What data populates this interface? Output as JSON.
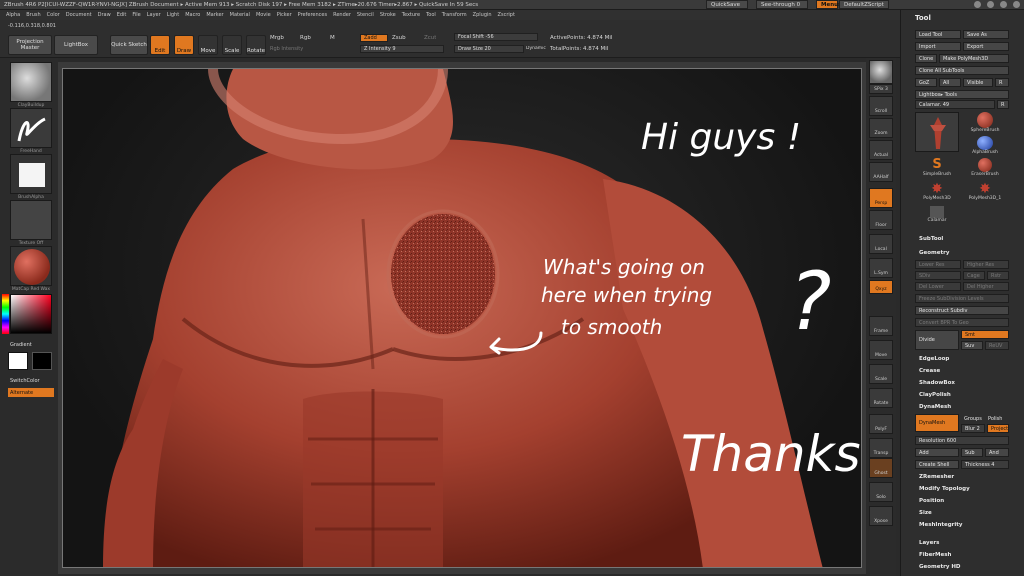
{
  "titlebar": {
    "app_title": "ZBrush 4R6 P2[ICUI-WZZF-QW1R-YNVI-NGJX]    ZBrush Document    ▸ Active Mem 913 ▸ Scratch Disk 197 ▸ Free Mem 3182 ▸ ZTime▸20.676 Timer▸2.867 ▸ QuickSave In 59 Secs",
    "quicksave": "QuickSave",
    "seethrough": "See-through  0",
    "menus": "Menus",
    "script": "DefaultZScript"
  },
  "menubar": [
    "Alpha",
    "Brush",
    "Color",
    "Document",
    "Draw",
    "Edit",
    "File",
    "Layer",
    "Light",
    "Macro",
    "Marker",
    "Material",
    "Movie",
    "Picker",
    "Preferences",
    "Render",
    "Stencil",
    "Stroke",
    "Texture",
    "Tool",
    "Transform",
    "Zplugin",
    "Zscript"
  ],
  "shelf": {
    "coords": "-0.116,0.318,0.801",
    "projection_master": "Projection Master",
    "lightbox": "LightBox",
    "quick_sketch": "Quick Sketch",
    "edit": "Edit",
    "draw": "Draw",
    "move": "Move",
    "scale": "Scale",
    "rotate": "Rotate",
    "mrgb": "Mrgb",
    "rgb": "Rgb",
    "m": "M",
    "rgb_intensity": "Rgb Intensity",
    "zadd": "Zadd",
    "zsub": "Zsub",
    "zcut": "Zcut",
    "z_intensity": "Z Intensity 9",
    "focal_shift": "Focal Shift -56",
    "draw_size": "Draw Size 20",
    "dynamic": "Dynamic",
    "active_points": "ActivePoints: 4.874 Mil",
    "total_points": "TotalPoints: 4.874 Mil"
  },
  "lefttray": {
    "brush_label": "ClayBuildup",
    "stroke_label": "FreeHand",
    "alpha_label": "BrushAlpha",
    "texture_label": "Texture Off",
    "material_label": "MatCap Red Wax",
    "gradient": "Gradient",
    "switch_color": "SwitchColor",
    "alternate": "Alternate"
  },
  "rightshelf": [
    "SPix 3",
    "Scroll",
    "Zoom",
    "Actual",
    "AAHalf",
    "Persp",
    "Floor",
    "Local",
    "L.Sym",
    "Qxyz",
    "Frame",
    "Move",
    "Scale",
    "Rotate",
    "PolyF",
    "Transp",
    "Ghost",
    "Solo",
    "Xpose"
  ],
  "palette": {
    "title": "Tool",
    "load_tool": "Load Tool",
    "save_as": "Save As",
    "import": "Import",
    "export": "Export",
    "clone": "Clone",
    "make_polymesh": "Make PolyMesh3D",
    "clone_all": "Clone All SubTools",
    "goz": "GoZ",
    "all": "All",
    "visible": "Visible",
    "r": "R",
    "lightbox_tools": "Lightbox▸ Tools",
    "calamar": "Calamar. 49",
    "brushes": [
      "SphereBrush",
      "AlphaBrush",
      "SimpleBrush",
      "EraserBrush",
      "PolyMesh3D",
      "PolyMesh3D_1",
      "Calamar"
    ],
    "subtool": "SubTool",
    "geometry": "Geometry",
    "lower_res": "Lower Res",
    "higher_res": "Higher Res",
    "sdiv": "SDiv",
    "cage": "Cage",
    "rstr": "Rstr",
    "del_lower": "Del Lower",
    "del_higher": "Del Higher",
    "freeze_subdiv": "Freeze SubDivision Levels",
    "reconstruct": "Reconstruct Subdiv",
    "convert_bpr": "Convert BPR To Geo",
    "divide": "Divide",
    "smt": "Smt",
    "suv": "Suv",
    "reuv": "ReUV",
    "edgeloop": "EdgeLoop",
    "crease": "Crease",
    "shadowbox": "ShadowBox",
    "claypolish": "ClayPolish",
    "dynamesh_section": "DynaMesh",
    "dynamesh_btn": "DynaMesh",
    "groups": "Groups",
    "polish": "Polish",
    "blur": "Blur 2",
    "project": "Project",
    "resolution": "Resolution 600",
    "add": "Add",
    "sub": "Sub",
    "and": "And",
    "create_shell": "Create Shell",
    "thickness": "Thickness 4",
    "zremesher": "ZRemesher",
    "modify_topology": "Modify Topology",
    "position": "Position",
    "size": "Size",
    "meshintegrity": "MeshIntegrity",
    "layers": "Layers",
    "fibermesh": "FiberMesh",
    "geometry_hd": "Geometry HD"
  },
  "annotations": {
    "hi": "Hi guys !",
    "question1": "What's going on",
    "question2": "here when trying",
    "question3": "to smooth",
    "question_mark": "?",
    "thanks": "Thanks !"
  },
  "colors": {
    "accent": "#e07820",
    "skin": "#b9503f",
    "skin_dark": "#6e2418"
  }
}
